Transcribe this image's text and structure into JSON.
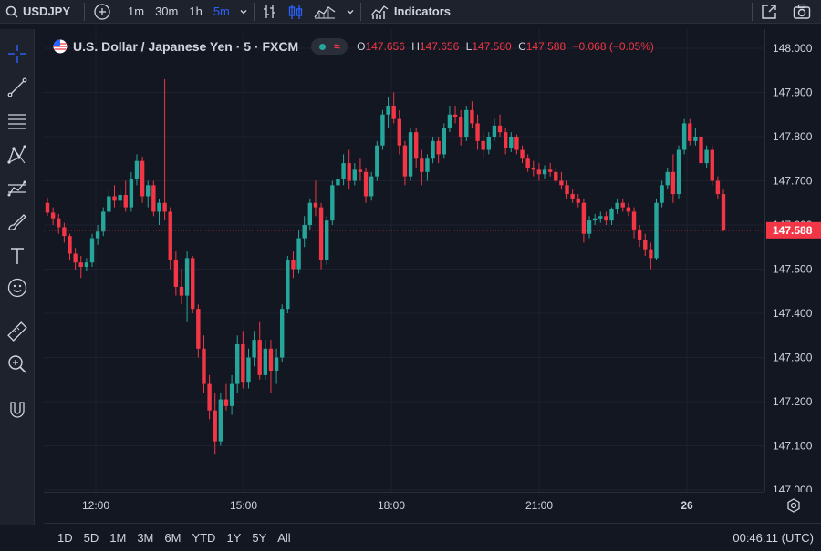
{
  "topbar": {
    "symbol": "USDJPY",
    "intervals": [
      "1m",
      "30m",
      "1h",
      "5m"
    ],
    "active_interval": "5m",
    "indicators_label": "Indicators"
  },
  "legend": {
    "title": "U.S. Dollar / Japanese Yen · 5 · FXCM",
    "o_label": "O",
    "o": "147.656",
    "h_label": "H",
    "h": "147.656",
    "l_label": "L",
    "l": "147.580",
    "c_label": "C",
    "c": "147.588",
    "change": "−0.068 (−0.05%)"
  },
  "price_axis": {
    "ticks": [
      "148.000",
      "147.900",
      "147.800",
      "147.700",
      "147.600",
      "147.500",
      "147.400",
      "147.300",
      "147.200",
      "147.100",
      "147.000"
    ],
    "current_price": "147.588"
  },
  "time_axis": {
    "labels": [
      "12:00",
      "15:00",
      "18:00",
      "21:00",
      "26"
    ]
  },
  "bottombar": {
    "ranges": [
      "1D",
      "5D",
      "1M",
      "3M",
      "6M",
      "YTD",
      "1Y",
      "5Y",
      "All"
    ],
    "clock": "00:46:11 (UTC)"
  },
  "colors": {
    "up": "#26a69a",
    "down": "#f23645",
    "accent": "#2962ff",
    "background": "#131722"
  },
  "chart_data": {
    "type": "candlestick",
    "ylim": [
      147.0,
      148.0
    ],
    "x_ticks": [
      "12:00",
      "15:00",
      "18:00",
      "21:00",
      "26"
    ],
    "candles": [
      [
        147.65,
        147.662,
        147.62,
        147.628
      ],
      [
        147.628,
        147.64,
        147.6,
        147.615
      ],
      [
        147.615,
        147.625,
        147.58,
        147.595
      ],
      [
        147.595,
        147.605,
        147.56,
        147.575
      ],
      [
        147.575,
        147.58,
        147.52,
        147.535
      ],
      [
        147.535,
        147.548,
        147.498,
        147.515
      ],
      [
        147.515,
        147.53,
        147.48,
        147.505
      ],
      [
        147.505,
        147.525,
        147.495,
        147.515
      ],
      [
        147.515,
        147.58,
        147.505,
        147.57
      ],
      [
        147.57,
        147.6,
        147.555,
        147.585
      ],
      [
        147.585,
        147.64,
        147.575,
        147.63
      ],
      [
        147.63,
        147.68,
        147.62,
        147.665
      ],
      [
        147.665,
        147.69,
        147.64,
        147.655
      ],
      [
        147.655,
        147.68,
        147.64,
        147.668
      ],
      [
        147.668,
        147.7,
        147.63,
        147.64
      ],
      [
        147.64,
        147.72,
        147.63,
        147.705
      ],
      [
        147.705,
        147.76,
        147.69,
        147.745
      ],
      [
        147.745,
        147.755,
        147.65,
        147.665
      ],
      [
        147.665,
        147.7,
        147.64,
        147.69
      ],
      [
        147.69,
        147.7,
        147.62,
        147.63
      ],
      [
        147.63,
        147.66,
        147.6,
        147.65
      ],
      [
        147.65,
        147.93,
        147.61,
        147.63
      ],
      [
        147.63,
        147.64,
        147.5,
        147.52
      ],
      [
        147.52,
        147.54,
        147.44,
        147.46
      ],
      [
        147.46,
        147.5,
        147.42,
        147.44
      ],
      [
        147.44,
        147.54,
        147.38,
        147.525
      ],
      [
        147.525,
        147.53,
        147.4,
        147.41
      ],
      [
        147.41,
        147.42,
        147.3,
        147.32
      ],
      [
        147.32,
        147.35,
        147.22,
        147.24
      ],
      [
        147.24,
        147.26,
        147.16,
        147.18
      ],
      [
        147.18,
        147.22,
        147.08,
        147.11
      ],
      [
        147.11,
        147.22,
        147.1,
        147.205
      ],
      [
        147.205,
        147.24,
        147.18,
        147.19
      ],
      [
        147.19,
        147.26,
        147.17,
        147.24
      ],
      [
        147.24,
        147.35,
        147.22,
        147.33
      ],
      [
        147.33,
        147.36,
        147.23,
        147.245
      ],
      [
        147.245,
        147.32,
        147.23,
        147.3
      ],
      [
        147.3,
        147.36,
        147.28,
        147.34
      ],
      [
        147.34,
        147.38,
        147.25,
        147.26
      ],
      [
        147.26,
        147.34,
        147.25,
        147.32
      ],
      [
        147.32,
        147.34,
        147.22,
        147.27
      ],
      [
        147.27,
        147.32,
        147.24,
        147.3
      ],
      [
        147.3,
        147.42,
        147.29,
        147.41
      ],
      [
        147.41,
        147.53,
        147.4,
        147.52
      ],
      [
        147.52,
        147.54,
        147.48,
        147.5
      ],
      [
        147.5,
        147.59,
        147.49,
        147.57
      ],
      [
        147.57,
        147.62,
        147.55,
        147.6
      ],
      [
        147.6,
        147.66,
        147.59,
        147.65
      ],
      [
        147.65,
        147.7,
        147.62,
        147.64
      ],
      [
        147.64,
        147.65,
        147.5,
        147.52
      ],
      [
        147.52,
        147.62,
        147.51,
        147.61
      ],
      [
        147.61,
        147.7,
        147.6,
        147.69
      ],
      [
        147.69,
        147.72,
        147.66,
        147.705
      ],
      [
        147.705,
        147.76,
        147.69,
        147.74
      ],
      [
        147.74,
        147.77,
        147.68,
        147.7
      ],
      [
        147.7,
        147.74,
        147.69,
        147.725
      ],
      [
        147.725,
        147.75,
        147.7,
        147.72
      ],
      [
        147.72,
        147.73,
        147.65,
        147.665
      ],
      [
        147.665,
        147.72,
        147.655,
        147.71
      ],
      [
        147.71,
        147.79,
        147.7,
        147.78
      ],
      [
        147.78,
        147.86,
        147.77,
        147.85
      ],
      [
        147.85,
        147.89,
        147.82,
        147.87
      ],
      [
        147.87,
        147.9,
        147.83,
        147.84
      ],
      [
        147.84,
        147.86,
        147.76,
        147.78
      ],
      [
        147.78,
        147.79,
        147.69,
        147.71
      ],
      [
        147.71,
        147.82,
        147.7,
        147.81
      ],
      [
        147.81,
        147.82,
        147.73,
        147.75
      ],
      [
        147.75,
        147.77,
        147.69,
        147.72
      ],
      [
        147.72,
        147.76,
        147.7,
        147.75
      ],
      [
        147.75,
        147.8,
        147.74,
        147.79
      ],
      [
        147.79,
        147.8,
        147.74,
        147.76
      ],
      [
        147.76,
        147.83,
        147.75,
        147.82
      ],
      [
        147.82,
        147.87,
        147.81,
        147.85
      ],
      [
        147.85,
        147.87,
        147.83,
        147.845
      ],
      [
        147.845,
        147.86,
        147.78,
        147.8
      ],
      [
        147.8,
        147.87,
        147.79,
        147.86
      ],
      [
        147.86,
        147.88,
        147.82,
        147.83
      ],
      [
        147.83,
        147.85,
        147.77,
        147.79
      ],
      [
        147.79,
        147.81,
        147.75,
        147.77
      ],
      [
        147.77,
        147.81,
        147.76,
        147.8
      ],
      [
        147.8,
        147.84,
        147.79,
        147.825
      ],
      [
        147.825,
        147.85,
        147.8,
        147.81
      ],
      [
        147.81,
        147.82,
        147.76,
        147.775
      ],
      [
        147.775,
        147.81,
        147.765,
        147.8
      ],
      [
        147.8,
        147.805,
        147.76,
        147.77
      ],
      [
        147.77,
        147.78,
        147.74,
        147.75
      ],
      [
        147.75,
        147.76,
        147.72,
        147.73
      ],
      [
        147.73,
        147.745,
        147.71,
        147.725
      ],
      [
        147.725,
        147.74,
        147.7,
        147.715
      ],
      [
        147.715,
        147.735,
        147.705,
        147.725
      ],
      [
        147.725,
        147.74,
        147.71,
        147.72
      ],
      [
        147.72,
        147.73,
        147.695,
        147.7
      ],
      [
        147.7,
        147.72,
        147.68,
        147.69
      ],
      [
        147.69,
        147.7,
        147.66,
        147.67
      ],
      [
        147.67,
        147.68,
        147.65,
        147.66
      ],
      [
        147.66,
        147.67,
        147.64,
        147.65
      ],
      [
        147.65,
        147.66,
        147.56,
        147.58
      ],
      [
        147.58,
        147.62,
        147.57,
        147.61
      ],
      [
        147.61,
        147.625,
        147.6,
        147.615
      ],
      [
        147.615,
        147.63,
        147.605,
        147.62
      ],
      [
        147.62,
        147.63,
        147.6,
        147.61
      ],
      [
        147.61,
        147.64,
        147.6,
        147.635
      ],
      [
        147.635,
        147.66,
        147.625,
        147.65
      ],
      [
        147.65,
        147.66,
        147.63,
        147.64
      ],
      [
        147.64,
        147.65,
        147.62,
        147.63
      ],
      [
        147.63,
        147.64,
        147.57,
        147.59
      ],
      [
        147.59,
        147.6,
        147.55,
        147.565
      ],
      [
        147.565,
        147.58,
        147.53,
        147.545
      ],
      [
        147.545,
        147.56,
        147.5,
        147.525
      ],
      [
        147.525,
        147.66,
        147.52,
        147.65
      ],
      [
        147.65,
        147.7,
        147.64,
        147.69
      ],
      [
        147.69,
        147.73,
        147.68,
        147.72
      ],
      [
        147.72,
        147.76,
        147.65,
        147.67
      ],
      [
        147.67,
        147.78,
        147.66,
        147.77
      ],
      [
        147.77,
        147.84,
        147.76,
        147.83
      ],
      [
        147.83,
        147.84,
        147.78,
        147.79
      ],
      [
        147.79,
        147.82,
        147.78,
        147.8
      ],
      [
        147.8,
        147.81,
        147.72,
        147.74
      ],
      [
        147.74,
        147.78,
        147.73,
        147.77
      ],
      [
        147.77,
        147.78,
        147.69,
        147.7
      ],
      [
        147.7,
        147.71,
        147.66,
        147.67
      ],
      [
        147.67,
        147.68,
        147.585,
        147.588
      ]
    ],
    "last_price": 147.588
  }
}
